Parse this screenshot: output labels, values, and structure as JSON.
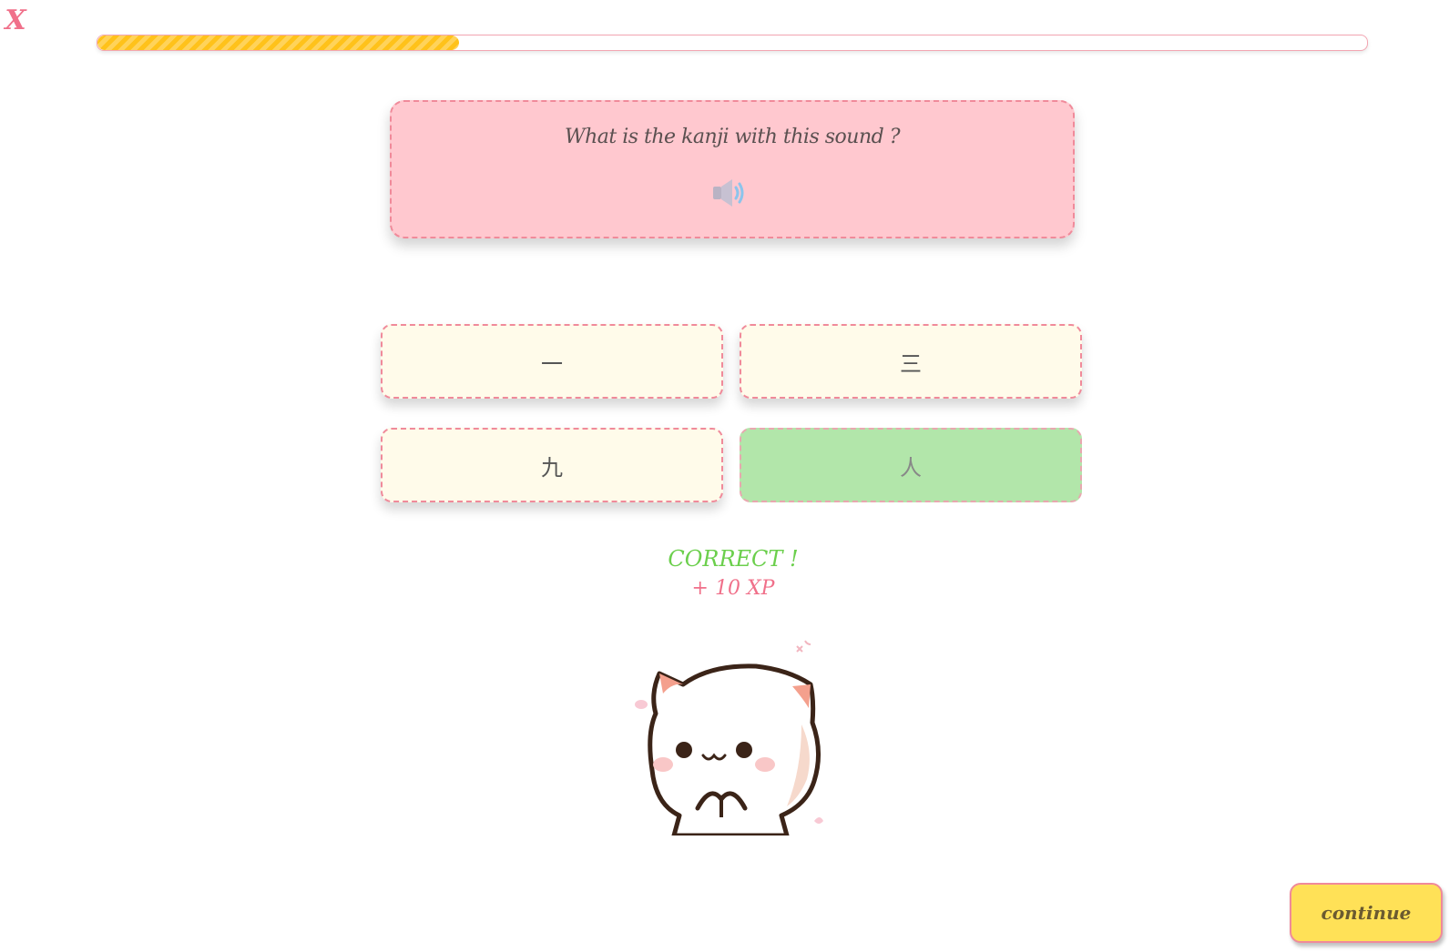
{
  "header": {
    "close_label": "X",
    "progress_fraction": 0.285
  },
  "question": {
    "prompt": "What is the kanji with this sound ?",
    "audio_icon": "speaker-icon"
  },
  "options": [
    {
      "label": "一",
      "state": "default"
    },
    {
      "label": "三",
      "state": "default"
    },
    {
      "label": "九",
      "state": "default"
    },
    {
      "label": "人",
      "state": "correct"
    }
  ],
  "feedback": {
    "result": "CORRECT !",
    "xp": "+ 10 XP",
    "mascot_icon": "cat-icon"
  },
  "footer": {
    "continue_label": "continue"
  },
  "colors": {
    "accent_pink": "#f0708a",
    "question_bg": "#ffc8cf",
    "option_bg": "#fffbea",
    "correct_bg": "#b2e6aa",
    "progress": "#ffc21a",
    "continue_bg": "#ffe157",
    "correct_text": "#6bcf4c"
  }
}
